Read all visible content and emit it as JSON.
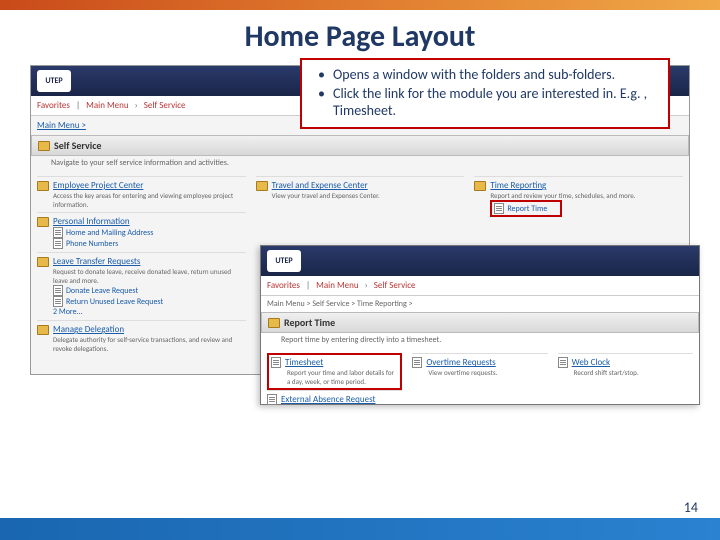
{
  "slide": {
    "title": "Home Page Layout",
    "page_number": "14"
  },
  "callout": {
    "b1": "Opens a window with the folders and sub-folders.",
    "b2": "Click the link for the module you are interested in. E.g. , Timesheet."
  },
  "shot1": {
    "logo": "UTEP",
    "crumb_fav": "Favorites",
    "crumb_main": "Main Menu",
    "crumb_ss": "Self Service",
    "mainmenu_link": "Main Menu >",
    "section": "Self Service",
    "section_blurb": "Navigate to your self service information and activities.",
    "modules": {
      "epc": {
        "title": "Employee Project Center",
        "desc": "Access the key areas for entering and viewing employee project information."
      },
      "tec": {
        "title": "Travel and Expense Center",
        "desc": "View your travel and Expenses Center."
      },
      "tr": {
        "title": "Time Reporting",
        "desc": "Report and review your time, schedules, and more.",
        "sub1": "Report Time"
      },
      "pi": {
        "title": "Personal Information",
        "sub1": "Home and Mailing Address",
        "sub2": "Phone Numbers"
      },
      "ltr": {
        "title": "Leave Transfer Requests",
        "desc": "Request to donate leave, receive donated leave, return unused leave and more.",
        "sub1": "Donate Leave Request",
        "sub2": "Return Unused Leave Request",
        "more": "2 More..."
      },
      "md": {
        "title": "Manage Delegation",
        "desc": "Delegate authority for self-service transactions, and review and revoke delegations."
      }
    }
  },
  "shot2": {
    "logo": "UTEP",
    "crumb_fav": "Favorites",
    "crumb_main": "Main Menu",
    "crumb_ss": "Self Service",
    "path": "Main Menu > Self Service > Time Reporting >",
    "section": "Report Time",
    "section_blurb": "Report time by entering directly into a timesheet.",
    "modules": {
      "ts": {
        "title": "Timesheet",
        "desc": "Report your time and labor details for a day, week, or time period."
      },
      "otr": {
        "title": "Overtime Requests",
        "desc": "View overtime requests."
      },
      "wc": {
        "title": "Web Clock",
        "desc": "Record shift start/stop."
      },
      "ear": {
        "title": "External Absence Request"
      }
    }
  }
}
